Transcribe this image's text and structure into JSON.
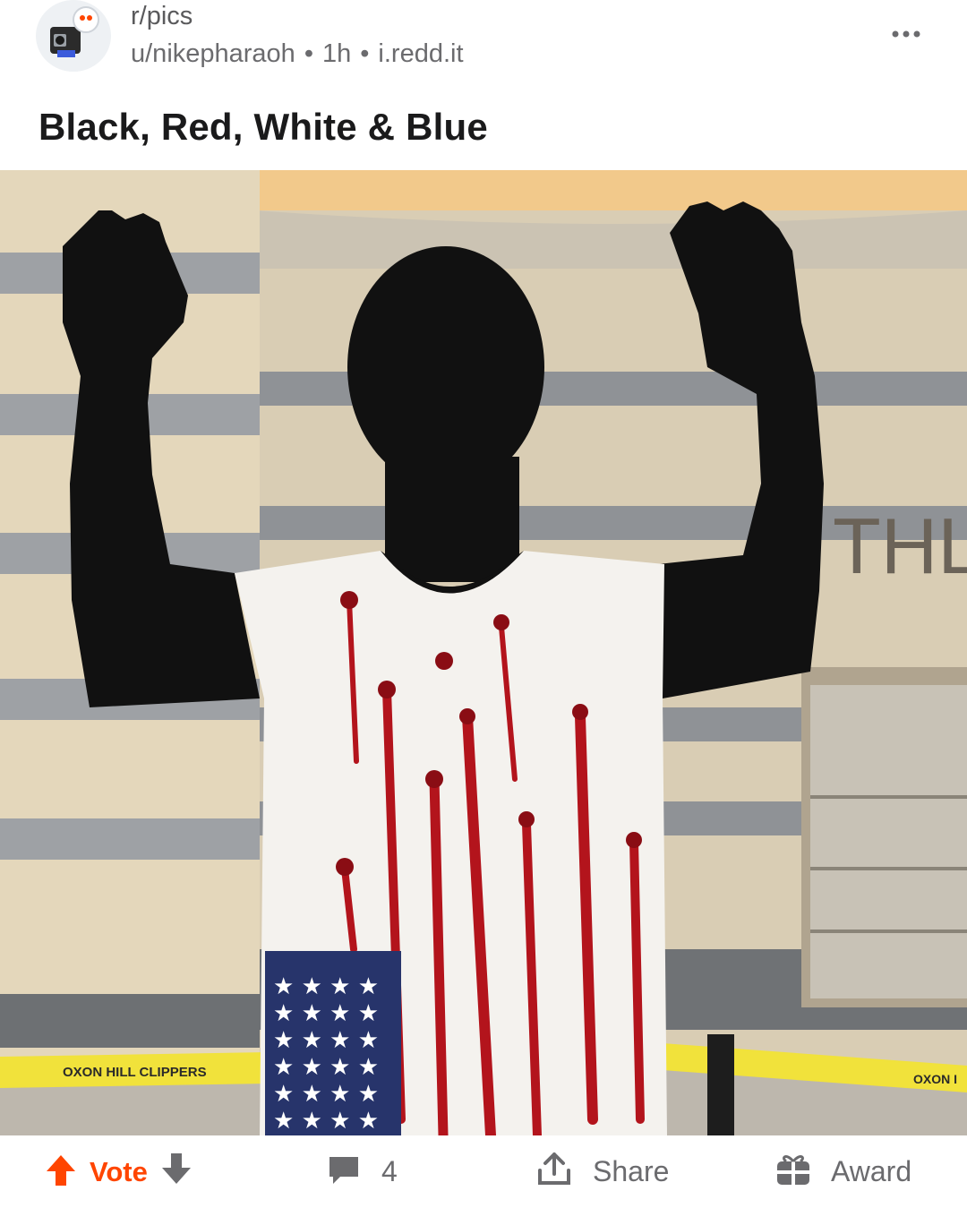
{
  "post": {
    "subreddit": "r/pics",
    "author": "u/nikepharaoh",
    "age": "1h",
    "domain": "i.redd.it",
    "title": "Black, Red, White & Blue"
  },
  "image": {
    "sign_letters": "THL",
    "tape_text_left": "OXON HILL CLIPPERS",
    "tape_text_right": "OXON I"
  },
  "actions": {
    "vote_label": "Vote",
    "comment_count": "4",
    "share_label": "Share",
    "award_label": "Award"
  },
  "icons": [
    "more-options-icon",
    "upvote-arrow-icon",
    "downvote-arrow-icon",
    "comment-bubble-icon",
    "share-icon",
    "award-icon"
  ],
  "colors": {
    "accent": "#ff4500",
    "muted": "#6b6b6e",
    "text": "#1a1a1b"
  }
}
